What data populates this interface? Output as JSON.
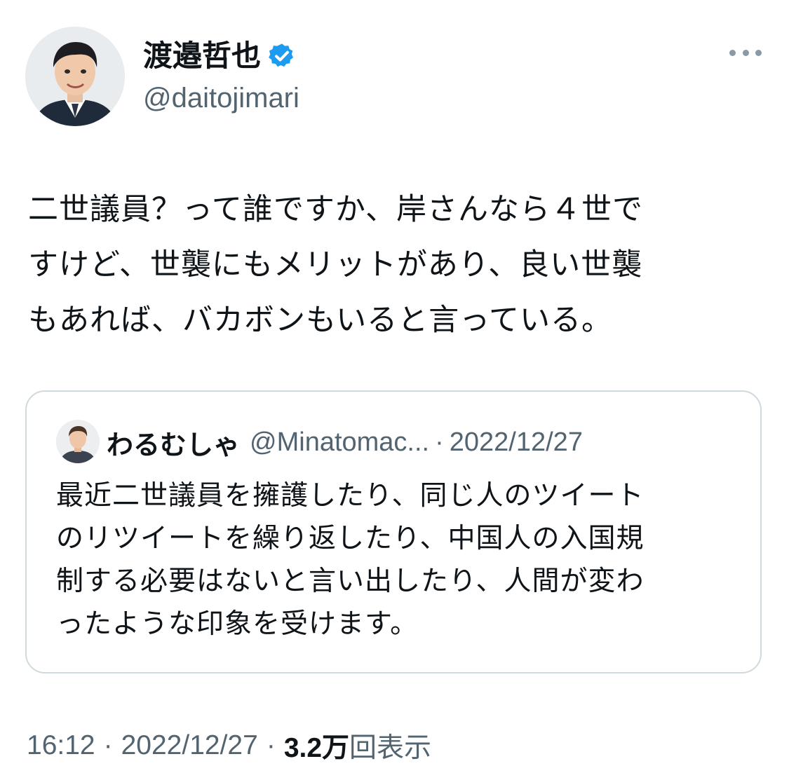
{
  "author": {
    "display_name": "渡邉哲也",
    "handle": "@daitojimari",
    "verified_icon": "verified-badge-icon",
    "verified_color": "#1d9bf0"
  },
  "more_icon": "more-horizontal-icon",
  "tweet": {
    "lines": [
      "二世議員？って誰ですか、岸さんなら４世で",
      "すけど、世襲にもメリットがあり、良い世襲",
      "もあれば、バカボンもいると言っている。"
    ]
  },
  "quote": {
    "display_name": "わるむしゃ",
    "handle": "@Minatomac...",
    "separator": "·",
    "date": "2022/12/27",
    "lines": [
      "最近二世議員を擁護したり、同じ人のツイート",
      "のリツイートを繰り返したり、中国人の入国規",
      "制する必要はないと言い出したり、人間が変わ",
      "ったような印象を受けます。"
    ]
  },
  "meta": {
    "time": "16:12",
    "separator": "·",
    "date": "2022/12/27",
    "views_count": "3.2万",
    "views_label": "回表示"
  },
  "colors": {
    "text": "#0f1419",
    "secondary": "#536471",
    "border": "#cfd9de",
    "accent": "#1d9bf0"
  }
}
